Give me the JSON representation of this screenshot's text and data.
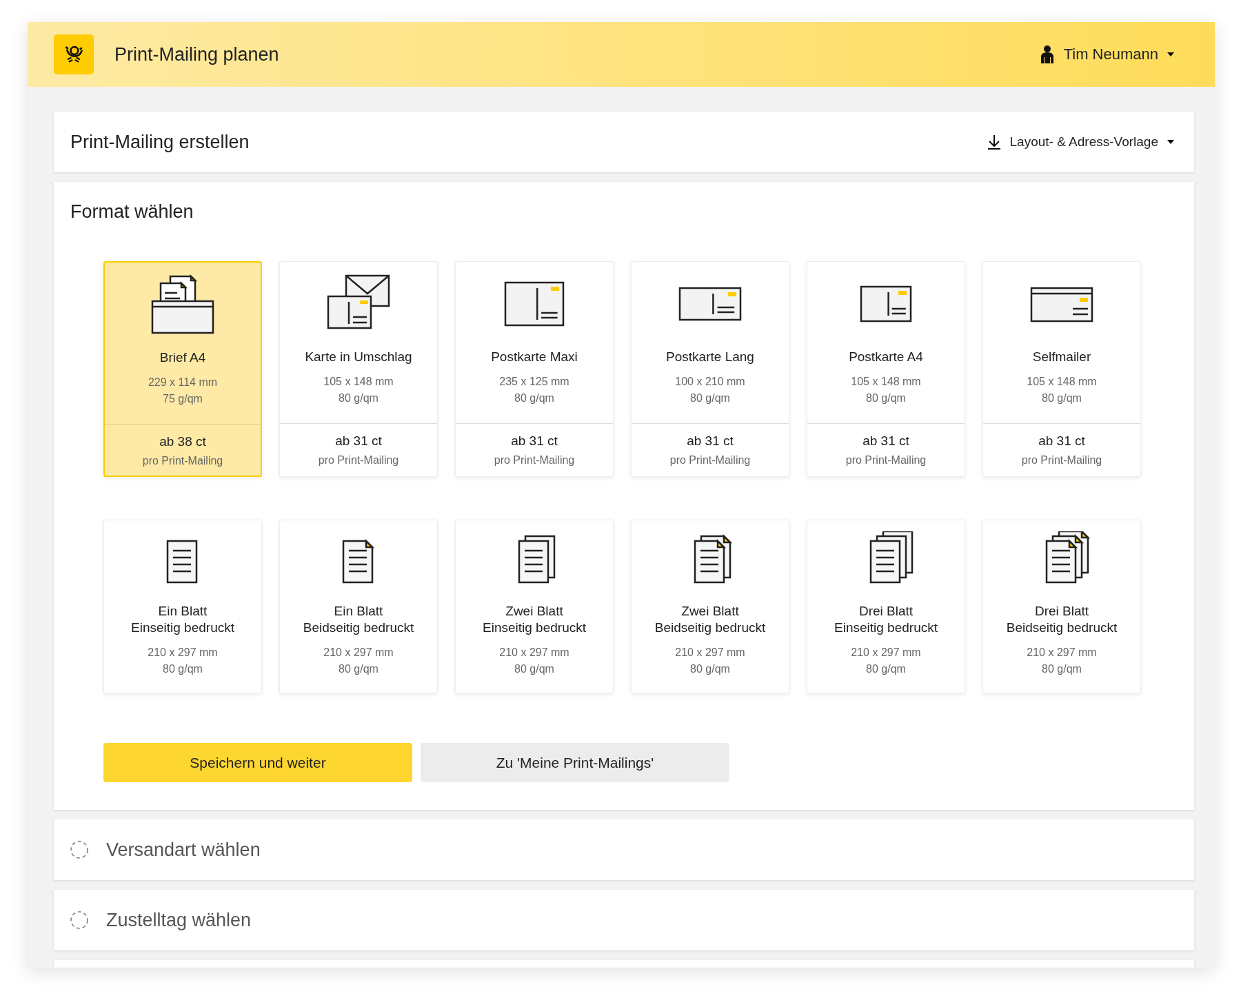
{
  "header": {
    "title": "Print-Mailing planen",
    "user": "Tim Neumann"
  },
  "create_panel": {
    "title": "Print-Mailing erstellen",
    "template_menu": "Layout- & Adress-Vorlage"
  },
  "format_panel": {
    "title": "Format wählen",
    "formats": [
      {
        "kind": "letter",
        "name": "Brief A4",
        "size": "229 x 114 mm",
        "weight": "75 g/qm",
        "price": "ab 38 ct",
        "price_note": "pro Print-Mailing",
        "selected": true
      },
      {
        "kind": "card-envelope",
        "name": "Karte in Umschlag",
        "size": "105 x 148 mm",
        "weight": "80 g/qm",
        "price": "ab 31 ct",
        "price_note": "pro Print-Mailing",
        "selected": false
      },
      {
        "kind": "postcard-maxi",
        "name": "Postkarte Maxi",
        "size": "235 x 125 mm",
        "weight": "80 g/qm",
        "price": "ab 31 ct",
        "price_note": "pro Print-Mailing",
        "selected": false
      },
      {
        "kind": "postcard-long",
        "name": "Postkarte Lang",
        "size": "100 x 210 mm",
        "weight": "80 g/qm",
        "price": "ab 31 ct",
        "price_note": "pro Print-Mailing",
        "selected": false
      },
      {
        "kind": "postcard-a4",
        "name": "Postkarte A4",
        "size": "105 x 148 mm",
        "weight": "80 g/qm",
        "price": "ab 31 ct",
        "price_note": "pro Print-Mailing",
        "selected": false
      },
      {
        "kind": "selfmailer",
        "name": "Selfmailer",
        "size": "105 x 148 mm",
        "weight": "80 g/qm",
        "price": "ab 31 ct",
        "price_note": "pro Print-Mailing",
        "selected": false
      }
    ],
    "sheet_options": [
      {
        "kind": "one-simplex",
        "name": "Ein Blatt",
        "print": "Einseitig bedruckt",
        "size": "210 x 297 mm",
        "weight": "80 g/qm",
        "selected": false
      },
      {
        "kind": "one-duplex",
        "name": "Ein Blatt",
        "print": "Beidseitig bedruckt",
        "size": "210 x 297 mm",
        "weight": "80 g/qm",
        "selected": false
      },
      {
        "kind": "two-simplex",
        "name": "Zwei Blatt",
        "print": "Einseitig bedruckt",
        "size": "210 x 297 mm",
        "weight": "80 g/qm",
        "selected": false
      },
      {
        "kind": "two-duplex",
        "name": "Zwei Blatt",
        "print": "Beidseitig bedruckt",
        "size": "210 x 297 mm",
        "weight": "80 g/qm",
        "selected": false
      },
      {
        "kind": "three-simplex",
        "name": "Drei Blatt",
        "print": "Einseitig bedruckt",
        "size": "210 x 297 mm",
        "weight": "80 g/qm",
        "selected": false
      },
      {
        "kind": "three-duplex",
        "name": "Drei Blatt",
        "print": "Beidseitig bedruckt",
        "size": "210 x 297 mm",
        "weight": "80 g/qm",
        "selected": false
      }
    ],
    "buttons": [
      {
        "kind": "primary",
        "label": "Speichern und weiter"
      },
      {
        "kind": "secondary",
        "label": "Zu 'Meine Print-Mailings'"
      }
    ]
  },
  "steps": [
    {
      "title": "Versandart wählen"
    },
    {
      "title": "Zustelltag wählen"
    }
  ]
}
